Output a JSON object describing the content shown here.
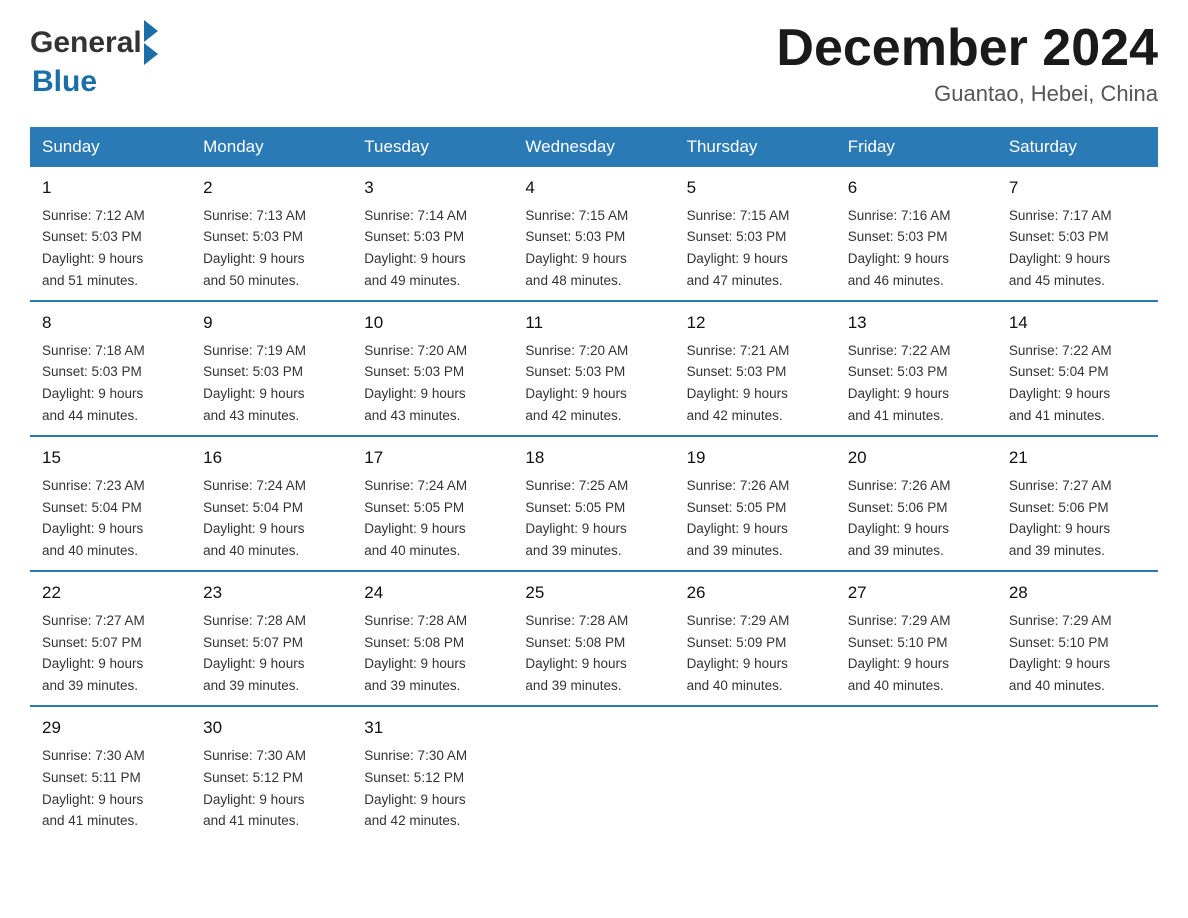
{
  "header": {
    "logo_general": "General",
    "logo_blue": "Blue",
    "month_title": "December 2024",
    "location": "Guantao, Hebei, China"
  },
  "columns": [
    "Sunday",
    "Monday",
    "Tuesday",
    "Wednesday",
    "Thursday",
    "Friday",
    "Saturday"
  ],
  "weeks": [
    [
      {
        "day": "1",
        "sunrise": "7:12 AM",
        "sunset": "5:03 PM",
        "daylight": "9 hours and 51 minutes."
      },
      {
        "day": "2",
        "sunrise": "7:13 AM",
        "sunset": "5:03 PM",
        "daylight": "9 hours and 50 minutes."
      },
      {
        "day": "3",
        "sunrise": "7:14 AM",
        "sunset": "5:03 PM",
        "daylight": "9 hours and 49 minutes."
      },
      {
        "day": "4",
        "sunrise": "7:15 AM",
        "sunset": "5:03 PM",
        "daylight": "9 hours and 48 minutes."
      },
      {
        "day": "5",
        "sunrise": "7:15 AM",
        "sunset": "5:03 PM",
        "daylight": "9 hours and 47 minutes."
      },
      {
        "day": "6",
        "sunrise": "7:16 AM",
        "sunset": "5:03 PM",
        "daylight": "9 hours and 46 minutes."
      },
      {
        "day": "7",
        "sunrise": "7:17 AM",
        "sunset": "5:03 PM",
        "daylight": "9 hours and 45 minutes."
      }
    ],
    [
      {
        "day": "8",
        "sunrise": "7:18 AM",
        "sunset": "5:03 PM",
        "daylight": "9 hours and 44 minutes."
      },
      {
        "day": "9",
        "sunrise": "7:19 AM",
        "sunset": "5:03 PM",
        "daylight": "9 hours and 43 minutes."
      },
      {
        "day": "10",
        "sunrise": "7:20 AM",
        "sunset": "5:03 PM",
        "daylight": "9 hours and 43 minutes."
      },
      {
        "day": "11",
        "sunrise": "7:20 AM",
        "sunset": "5:03 PM",
        "daylight": "9 hours and 42 minutes."
      },
      {
        "day": "12",
        "sunrise": "7:21 AM",
        "sunset": "5:03 PM",
        "daylight": "9 hours and 42 minutes."
      },
      {
        "day": "13",
        "sunrise": "7:22 AM",
        "sunset": "5:03 PM",
        "daylight": "9 hours and 41 minutes."
      },
      {
        "day": "14",
        "sunrise": "7:22 AM",
        "sunset": "5:04 PM",
        "daylight": "9 hours and 41 minutes."
      }
    ],
    [
      {
        "day": "15",
        "sunrise": "7:23 AM",
        "sunset": "5:04 PM",
        "daylight": "9 hours and 40 minutes."
      },
      {
        "day": "16",
        "sunrise": "7:24 AM",
        "sunset": "5:04 PM",
        "daylight": "9 hours and 40 minutes."
      },
      {
        "day": "17",
        "sunrise": "7:24 AM",
        "sunset": "5:05 PM",
        "daylight": "9 hours and 40 minutes."
      },
      {
        "day": "18",
        "sunrise": "7:25 AM",
        "sunset": "5:05 PM",
        "daylight": "9 hours and 39 minutes."
      },
      {
        "day": "19",
        "sunrise": "7:26 AM",
        "sunset": "5:05 PM",
        "daylight": "9 hours and 39 minutes."
      },
      {
        "day": "20",
        "sunrise": "7:26 AM",
        "sunset": "5:06 PM",
        "daylight": "9 hours and 39 minutes."
      },
      {
        "day": "21",
        "sunrise": "7:27 AM",
        "sunset": "5:06 PM",
        "daylight": "9 hours and 39 minutes."
      }
    ],
    [
      {
        "day": "22",
        "sunrise": "7:27 AM",
        "sunset": "5:07 PM",
        "daylight": "9 hours and 39 minutes."
      },
      {
        "day": "23",
        "sunrise": "7:28 AM",
        "sunset": "5:07 PM",
        "daylight": "9 hours and 39 minutes."
      },
      {
        "day": "24",
        "sunrise": "7:28 AM",
        "sunset": "5:08 PM",
        "daylight": "9 hours and 39 minutes."
      },
      {
        "day": "25",
        "sunrise": "7:28 AM",
        "sunset": "5:08 PM",
        "daylight": "9 hours and 39 minutes."
      },
      {
        "day": "26",
        "sunrise": "7:29 AM",
        "sunset": "5:09 PM",
        "daylight": "9 hours and 40 minutes."
      },
      {
        "day": "27",
        "sunrise": "7:29 AM",
        "sunset": "5:10 PM",
        "daylight": "9 hours and 40 minutes."
      },
      {
        "day": "28",
        "sunrise": "7:29 AM",
        "sunset": "5:10 PM",
        "daylight": "9 hours and 40 minutes."
      }
    ],
    [
      {
        "day": "29",
        "sunrise": "7:30 AM",
        "sunset": "5:11 PM",
        "daylight": "9 hours and 41 minutes."
      },
      {
        "day": "30",
        "sunrise": "7:30 AM",
        "sunset": "5:12 PM",
        "daylight": "9 hours and 41 minutes."
      },
      {
        "day": "31",
        "sunrise": "7:30 AM",
        "sunset": "5:12 PM",
        "daylight": "9 hours and 42 minutes."
      },
      null,
      null,
      null,
      null
    ]
  ],
  "labels": {
    "sunrise": "Sunrise:",
    "sunset": "Sunset:",
    "daylight": "Daylight:"
  }
}
